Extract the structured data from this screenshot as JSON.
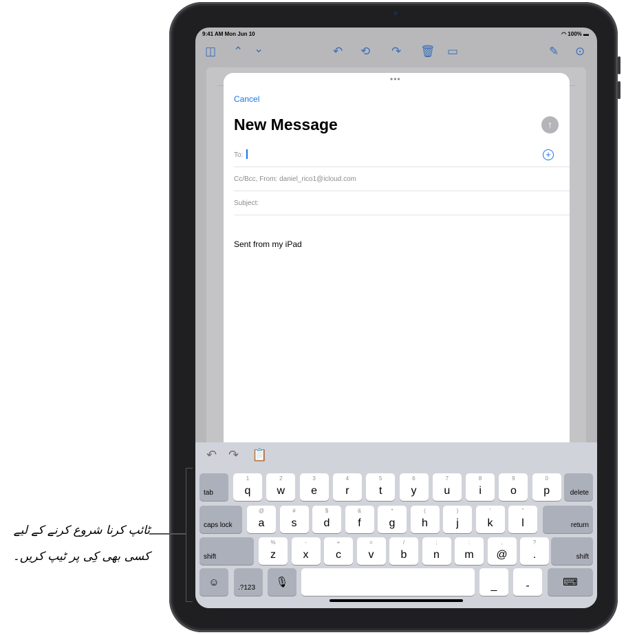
{
  "status": {
    "time_date": "9:41 AM  Mon Jun 10",
    "battery": "100%"
  },
  "toolbar": {
    "sidebar_icon": "sidebar-icon",
    "icons": [
      "chevron-up-icon",
      "chevron-down-icon",
      "reply-icon",
      "reply-all-icon",
      "forward-icon",
      "trash-icon",
      "folder-icon",
      "compose-icon",
      "more-icon"
    ]
  },
  "compose": {
    "grabber": "•••",
    "cancel_label": "Cancel",
    "title": "New Message",
    "to_label": "To:",
    "ccbcc_label": "Cc/Bcc, From:  daniel_rico1@icloud.com",
    "subject_label": "Subject:",
    "body": "Sent from my iPad"
  },
  "keyboard": {
    "row1": [
      {
        "hint": "1",
        "key": "q"
      },
      {
        "hint": "2",
        "key": "w"
      },
      {
        "hint": "3",
        "key": "e"
      },
      {
        "hint": "4",
        "key": "r"
      },
      {
        "hint": "5",
        "key": "t"
      },
      {
        "hint": "6",
        "key": "y"
      },
      {
        "hint": "7",
        "key": "u"
      },
      {
        "hint": "8",
        "key": "i"
      },
      {
        "hint": "9",
        "key": "o"
      },
      {
        "hint": "0",
        "key": "p"
      }
    ],
    "row2": [
      {
        "hint": "@",
        "key": "a"
      },
      {
        "hint": "#",
        "key": "s"
      },
      {
        "hint": "$",
        "key": "d"
      },
      {
        "hint": "&",
        "key": "f"
      },
      {
        "hint": "*",
        "key": "g"
      },
      {
        "hint": "(",
        "key": "h"
      },
      {
        "hint": ")",
        "key": "j"
      },
      {
        "hint": "'",
        "key": "k"
      },
      {
        "hint": "\"",
        "key": "l"
      }
    ],
    "row3": [
      {
        "hint": "%",
        "key": "z"
      },
      {
        "hint": "-",
        "key": "x"
      },
      {
        "hint": "+",
        "key": "c"
      },
      {
        "hint": "=",
        "key": "v"
      },
      {
        "hint": "/",
        "key": "b"
      },
      {
        "hint": ";",
        "key": "n"
      },
      {
        "hint": ":",
        "key": "m"
      },
      {
        "hint": ",",
        "key": "@"
      },
      {
        "hint": "?",
        "key": "."
      }
    ],
    "tab": "tab",
    "delete": "delete",
    "caps_lock": "caps lock",
    "return": "return",
    "shift": "shift",
    "num": ".?123",
    "underscore": "_",
    "dash": "-"
  },
  "callout": {
    "text": "ٹائپ کرنا شروع کرنے کے لیے کسی بھی کِی پر ٹیپ کریں۔"
  }
}
